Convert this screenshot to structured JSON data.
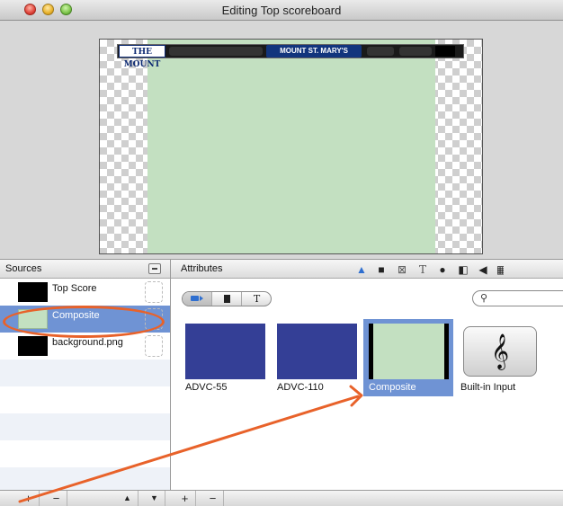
{
  "window": {
    "title": "Editing Top scoreboard"
  },
  "preview": {
    "scoreboard": {
      "logo_text": "THE MOUNT",
      "center_text": "MOUNT ST. MARY'S"
    }
  },
  "sources": {
    "header": "Sources",
    "items": [
      {
        "name": "Top Score",
        "thumb_color": "#000000",
        "selected": false
      },
      {
        "name": "Composite",
        "thumb_color": "#c3e0c1",
        "selected": true
      },
      {
        "name": "background.png",
        "thumb_color": "#000000",
        "selected": false
      }
    ]
  },
  "attributes": {
    "header": "Attributes",
    "segments": [
      "video-camera-icon",
      "document-icon",
      "T"
    ],
    "search": {
      "value": "",
      "placeholder": ""
    },
    "tiles": [
      {
        "label": "ADVC-55",
        "thumb_color": "#343f96",
        "selected": false
      },
      {
        "label": "ADVC-110",
        "thumb_color": "#343f96",
        "selected": false
      },
      {
        "label": "Composite",
        "thumb_color": "#c3e0c1",
        "selected": true
      },
      {
        "label": "Built-in Input",
        "icon": "treble-clef-icon",
        "selected": false
      }
    ]
  },
  "bottom_bar": {
    "add_label": "+",
    "remove_label": "−",
    "up_label": "▲",
    "down_label": "▼"
  },
  "annotation": {
    "color": "#e8622a"
  },
  "colors": {
    "selection": "#6f93d4",
    "canvas_green": "#c3e0c1",
    "tile_blue": "#343f96"
  }
}
